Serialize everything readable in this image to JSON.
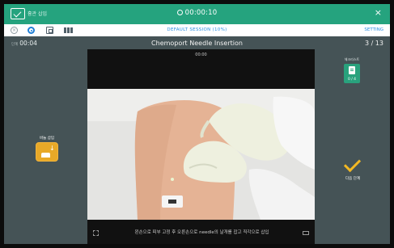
{
  "topbar": {
    "app_label": "흉관 삽입",
    "timer": "00:00:10",
    "close": "×"
  },
  "toolbar": {
    "session": "DEFAULT SESSION (10%)",
    "setting": "SETTING"
  },
  "header": {
    "step_small": "단계",
    "elapsed": "00:04",
    "title": "Chemoport Needle Insertion",
    "progress": "3 / 13"
  },
  "video": {
    "time": "00:00",
    "caption": "왼손으로 피부 고정 후 오른손으로 needle의 날개를 잡고 직각으로 삽입"
  },
  "left_panel": {
    "label": "바늘 삽입",
    "icon": "pin-insert-icon"
  },
  "right_panel": {
    "checklist_label": "체크리스트",
    "checklist_count": "0 / 4",
    "complete_label": "다음 단계"
  },
  "colors": {
    "topbar": "#25a37e",
    "background": "#455356",
    "accent": "#f3b823",
    "link": "#2b8de0"
  }
}
